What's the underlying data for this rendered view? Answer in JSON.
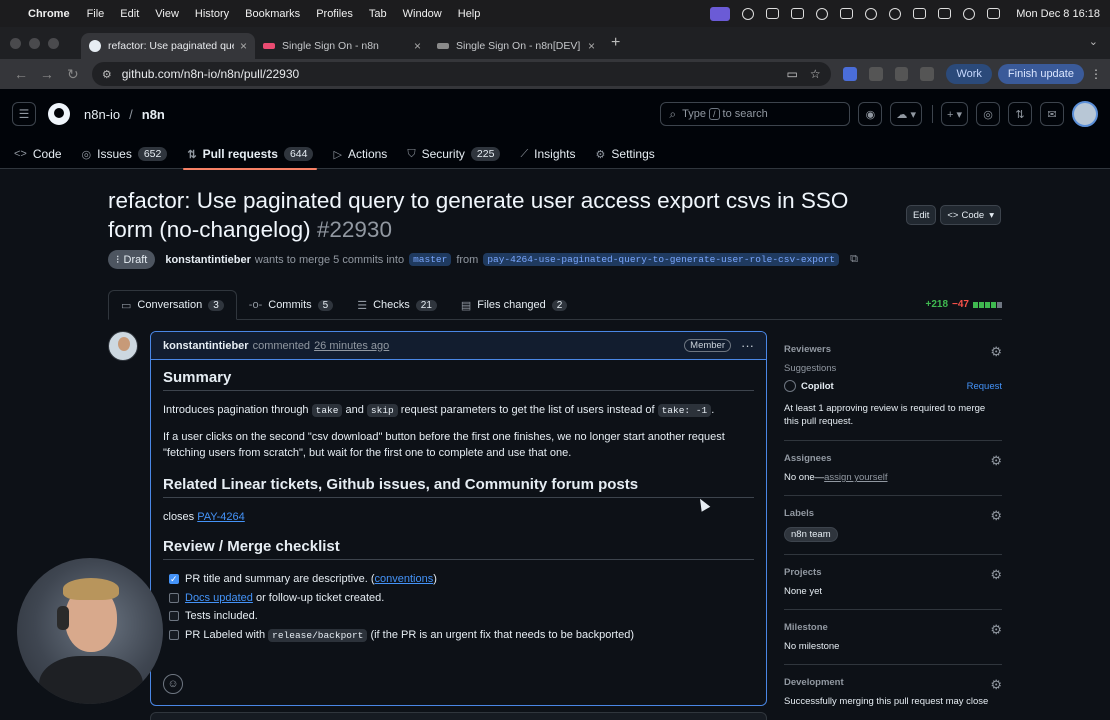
{
  "menubar": {
    "app": "Chrome",
    "items": [
      "File",
      "Edit",
      "View",
      "History",
      "Bookmarks",
      "Profiles",
      "Tab",
      "Window",
      "Help"
    ],
    "clock": "Mon Dec 8  16:18"
  },
  "tabs": [
    {
      "title": "refactor: Use paginated query to",
      "active": true,
      "favicon_color": "#e6edf3"
    },
    {
      "title": "Single Sign On - n8n",
      "active": false,
      "favicon_color": "#ea4b71"
    },
    {
      "title": "Single Sign On - n8n[DEV]",
      "active": false,
      "favicon_color": "#8a8a8a"
    }
  ],
  "omnibox": {
    "url": "github.com/n8n-io/n8n/pull/22930"
  },
  "profile": {
    "work": "Work",
    "finish": "Finish update"
  },
  "gh": {
    "owner": "n8n-io",
    "repo": "n8n",
    "search_prefix": "Type",
    "search_key": "/",
    "search_suffix": "to search",
    "nav": [
      {
        "label": "Code",
        "count": "",
        "icon": "code-icon"
      },
      {
        "label": "Issues",
        "count": "652",
        "icon": "issue-icon"
      },
      {
        "label": "Pull requests",
        "count": "644",
        "icon": "pull-request-icon",
        "selected": true
      },
      {
        "label": "Actions",
        "count": "",
        "icon": "play-icon"
      },
      {
        "label": "Security",
        "count": "225",
        "icon": "shield-icon"
      },
      {
        "label": "Insights",
        "count": "",
        "icon": "graph-icon"
      },
      {
        "label": "Settings",
        "count": "",
        "icon": "gear-icon"
      }
    ]
  },
  "pr": {
    "title": "refactor: Use paginated query to generate user access export csvs in SSO form (no-changelog)",
    "number": "#22930",
    "edit": "Edit",
    "code": "Code",
    "status": "Draft",
    "author": "konstantintieber",
    "merge_text": "wants to merge 5 commits into",
    "base": "master",
    "from": "from",
    "head": "pay-4264-use-paginated-query-to-generate-user-role-csv-export",
    "tabs": [
      {
        "label": "Conversation",
        "count": "3"
      },
      {
        "label": "Commits",
        "count": "5"
      },
      {
        "label": "Checks",
        "count": "21"
      },
      {
        "label": "Files changed",
        "count": "2"
      }
    ],
    "additions": "+218",
    "deletions": "−47"
  },
  "comment": {
    "author": "konstantintieber",
    "verb": "commented",
    "when": "26 minutes ago",
    "role": "Member",
    "h_summary": "Summary",
    "p1_a": "Introduces pagination through",
    "p1_code1": "take",
    "p1_b": "and",
    "p1_code2": "skip",
    "p1_c": "request parameters to get the list of users instead of",
    "p1_code3": "take: -1",
    "p1_d": ".",
    "p2": "If a user clicks on the second \"csv download\" button before the first one finishes, we no longer start another request \"fetching users from scratch\", but wait for the first one to complete and use that one.",
    "h_related": "Related Linear tickets, Github issues, and Community forum posts",
    "closes": "closes",
    "ticket": "PAY-4264",
    "h_checklist": "Review / Merge checklist",
    "c1_a": "PR title and summary are descriptive. (",
    "c1_link": "conventions",
    "c1_b": ")",
    "c2_link": "Docs updated",
    "c2_b": "or follow-up ticket created.",
    "c3": "Tests included.",
    "c4_a": "PR Labeled with",
    "c4_code": "release/backport",
    "c4_b": "(if the PR is an urgent fix that needs to be backported)"
  },
  "sidebar": {
    "reviewers": "Reviewers",
    "suggestions": "Suggestions",
    "copilot": "Copilot",
    "request": "Request",
    "review_note": "At least 1 approving review is required to merge this pull request.",
    "assignees": "Assignees",
    "no_one": "No one—",
    "assign_yourself": "assign yourself",
    "labels": "Labels",
    "label": "n8n team",
    "projects": "Projects",
    "none_yet": "None yet",
    "milestone": "Milestone",
    "no_milestone": "No milestone",
    "development": "Development",
    "dev_note": "Successfully merging this pull request may close"
  }
}
